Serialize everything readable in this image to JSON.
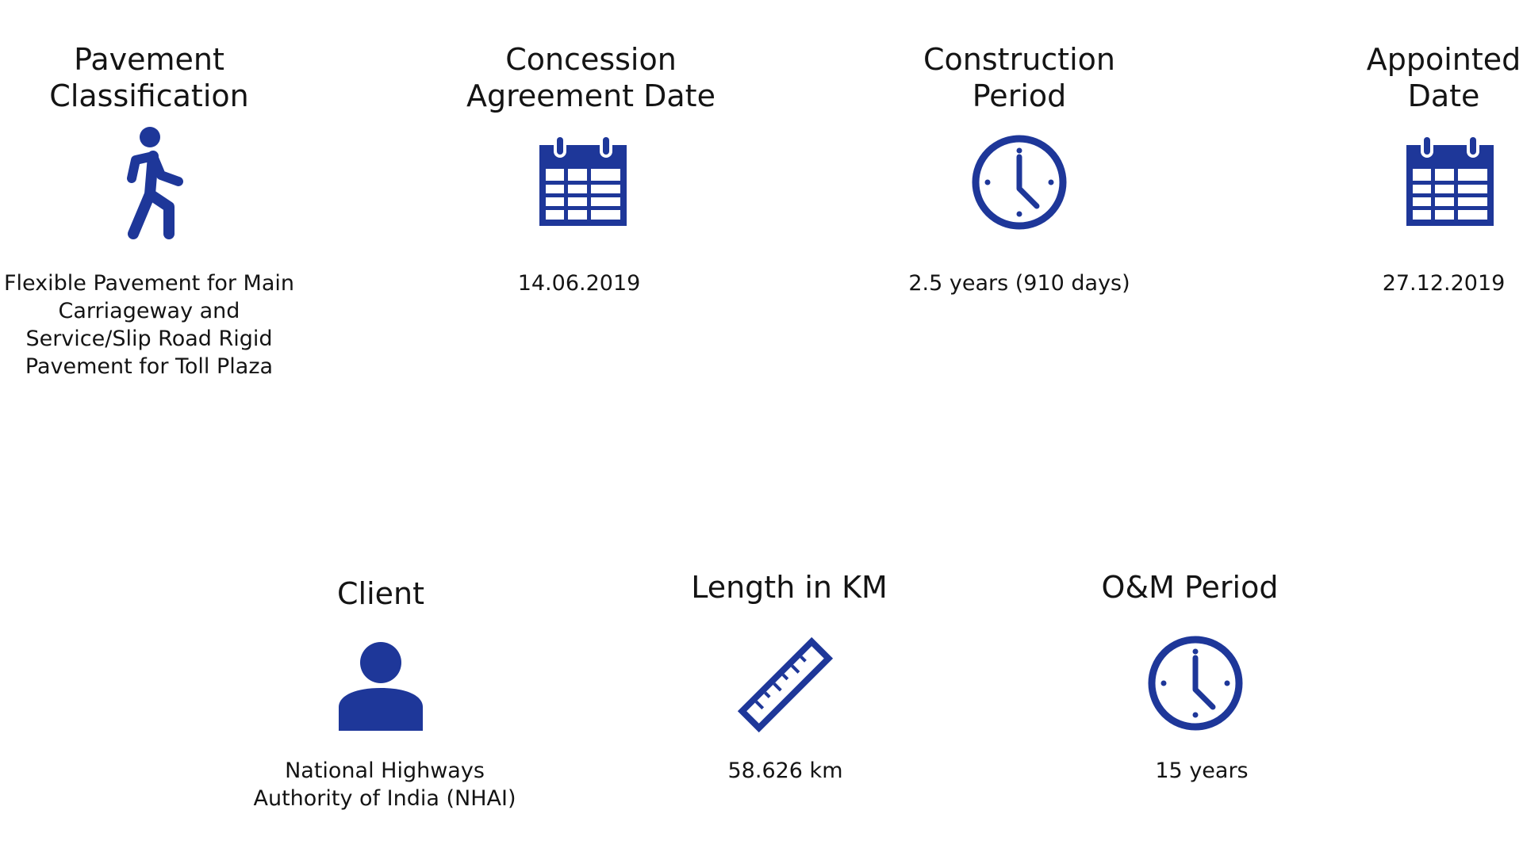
{
  "accent_color": "#1E3799",
  "items": [
    {
      "title": "Pavement\nClassification",
      "icon": "walking-person-icon",
      "value": "Flexible Pavement for Main\nCarriageway and\nService/Slip Road Rigid\nPavement for Toll Plaza"
    },
    {
      "title": "Concession\nAgreement Date",
      "icon": "calendar-icon",
      "value": "14.06.2019"
    },
    {
      "title": "Construction\nPeriod",
      "icon": "clock-icon",
      "value": "2.5 years (910 days)"
    },
    {
      "title": "Appointed\nDate",
      "icon": "calendar-icon",
      "value": "27.12.2019"
    },
    {
      "title": "Client",
      "icon": "person-icon",
      "value": "National Highways\nAuthority of India (NHAI)"
    },
    {
      "title": "Length in KM",
      "icon": "ruler-icon",
      "value": "58.626 km"
    },
    {
      "title": "O&M Period",
      "icon": "clock-icon",
      "value": "15 years"
    }
  ]
}
